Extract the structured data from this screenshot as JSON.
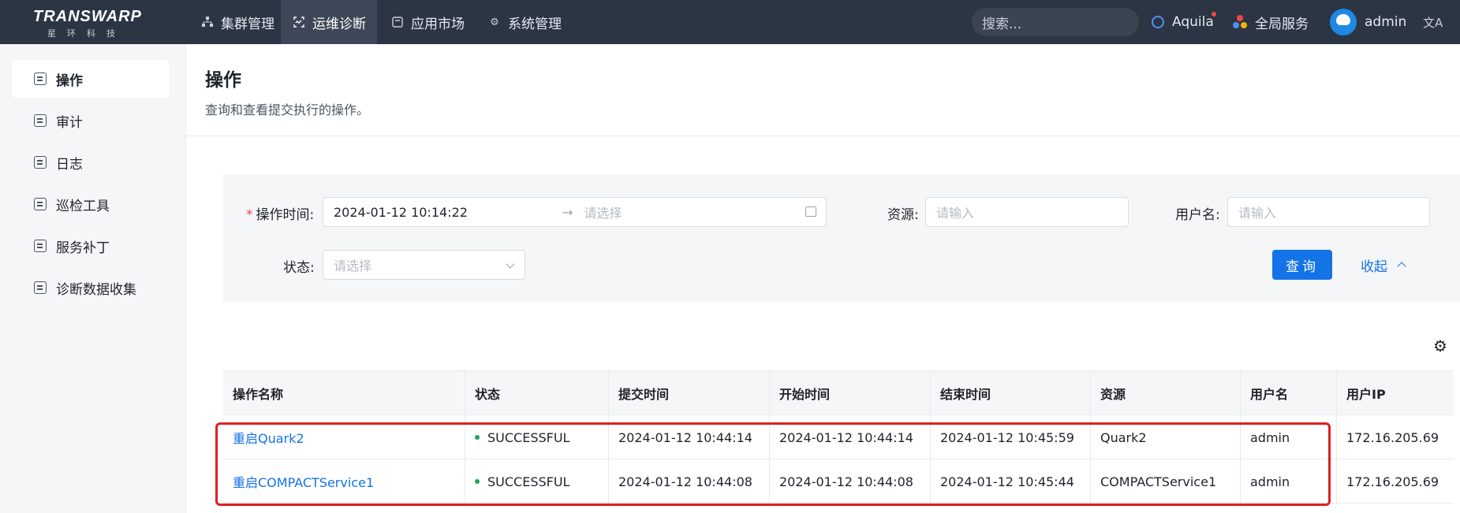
{
  "brand": {
    "name": "TRANSWARP",
    "subtitle": "星环科技"
  },
  "nav": {
    "items": [
      {
        "label": "集群管理",
        "icon": "cluster-icon"
      },
      {
        "label": "运维诊断",
        "icon": "diagnosis-icon",
        "active": true
      },
      {
        "label": "应用市场",
        "icon": "app-market-icon"
      },
      {
        "label": "系统管理",
        "icon": "gear-icon"
      }
    ],
    "search_placeholder": "搜索...",
    "aquila": "Aquila",
    "global_service": "全局服务",
    "user": "admin"
  },
  "sidebar": {
    "items": [
      {
        "label": "操作",
        "active": true
      },
      {
        "label": "审计"
      },
      {
        "label": "日志"
      },
      {
        "label": "巡检工具"
      },
      {
        "label": "服务补丁"
      },
      {
        "label": "诊断数据收集"
      }
    ]
  },
  "page": {
    "title": "操作",
    "description": "查询和查看提交执行的操作。"
  },
  "filters": {
    "time_label": "操作时间:",
    "time_required": "*",
    "time_start": "2024-01-12 10:14:22",
    "time_end_placeholder": "请选择",
    "resource_label": "资源:",
    "resource_placeholder": "请输入",
    "username_label": "用户名:",
    "username_placeholder": "请输入",
    "status_label": "状态:",
    "status_placeholder": "请选择",
    "query_button": "查询",
    "collapse_button": "收起"
  },
  "table": {
    "columns": [
      "操作名称",
      "状态",
      "提交时间",
      "开始时间",
      "结束时间",
      "资源",
      "用户名",
      "用户IP"
    ],
    "rows": [
      {
        "name": "重启Quark2",
        "status": "SUCCESSFUL",
        "submit": "2024-01-12 10:44:14",
        "start": "2024-01-12 10:44:14",
        "end": "2024-01-12 10:45:59",
        "resource": "Quark2",
        "user": "admin",
        "ip": "172.16.205.69"
      },
      {
        "name": "重启COMPACTService1",
        "status": "SUCCESSFUL",
        "submit": "2024-01-12 10:44:08",
        "start": "2024-01-12 10:44:08",
        "end": "2024-01-12 10:45:44",
        "resource": "COMPACTService1",
        "user": "admin",
        "ip": "172.16.205.69"
      }
    ]
  },
  "colors": {
    "topbar": "#2c3544",
    "accent": "#1473e6",
    "success": "#22a55b",
    "highlight": "#e02020"
  }
}
